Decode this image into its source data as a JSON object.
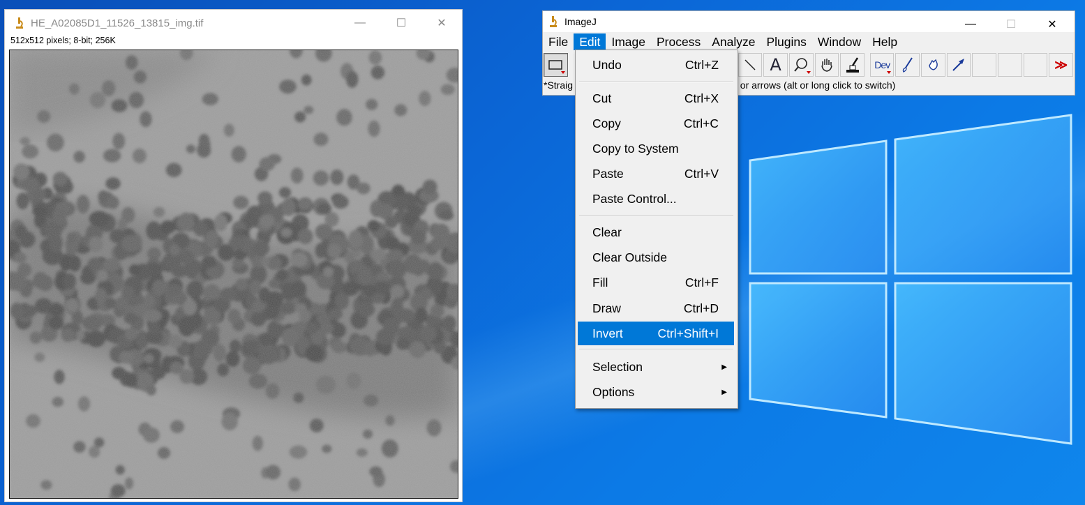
{
  "image_window": {
    "title": "HE_A02085D1_11526_13815_img.tif",
    "info": "512x512 pixels; 8-bit; 256K",
    "controls": {
      "minimize": "—",
      "maximize": "☐",
      "close": "✕"
    }
  },
  "imagej_window": {
    "title": "ImageJ",
    "controls": {
      "minimize": "—",
      "maximize": "☐",
      "close": "✕"
    },
    "menus": [
      "File",
      "Edit",
      "Image",
      "Process",
      "Analyze",
      "Plugins",
      "Window",
      "Help"
    ],
    "open_menu": "Edit",
    "status_left": "*Straig",
    "status_right": "s, or arrows (alt or long click to switch)",
    "tools": {
      "text": "A",
      "dev": "Dev",
      "more": "≫"
    }
  },
  "edit_menu": {
    "items": [
      {
        "label": "Undo",
        "shortcut": "Ctrl+Z"
      },
      {
        "label": "Cut",
        "shortcut": "Ctrl+X"
      },
      {
        "label": "Copy",
        "shortcut": "Ctrl+C"
      },
      {
        "label": "Copy to System",
        "shortcut": ""
      },
      {
        "label": "Paste",
        "shortcut": "Ctrl+V"
      },
      {
        "label": "Paste Control...",
        "shortcut": ""
      },
      {
        "label": "Clear",
        "shortcut": ""
      },
      {
        "label": "Clear Outside",
        "shortcut": ""
      },
      {
        "label": "Fill",
        "shortcut": "Ctrl+F"
      },
      {
        "label": "Draw",
        "shortcut": "Ctrl+D"
      },
      {
        "label": "Invert",
        "shortcut": "Ctrl+Shift+I"
      },
      {
        "label": "Selection",
        "shortcut": ""
      },
      {
        "label": "Options",
        "shortcut": ""
      }
    ],
    "highlighted": "Invert",
    "submenu_arrow": "▶"
  },
  "colors": {
    "menu_highlight": "#0078d7",
    "desktop": "#0b66d6"
  }
}
